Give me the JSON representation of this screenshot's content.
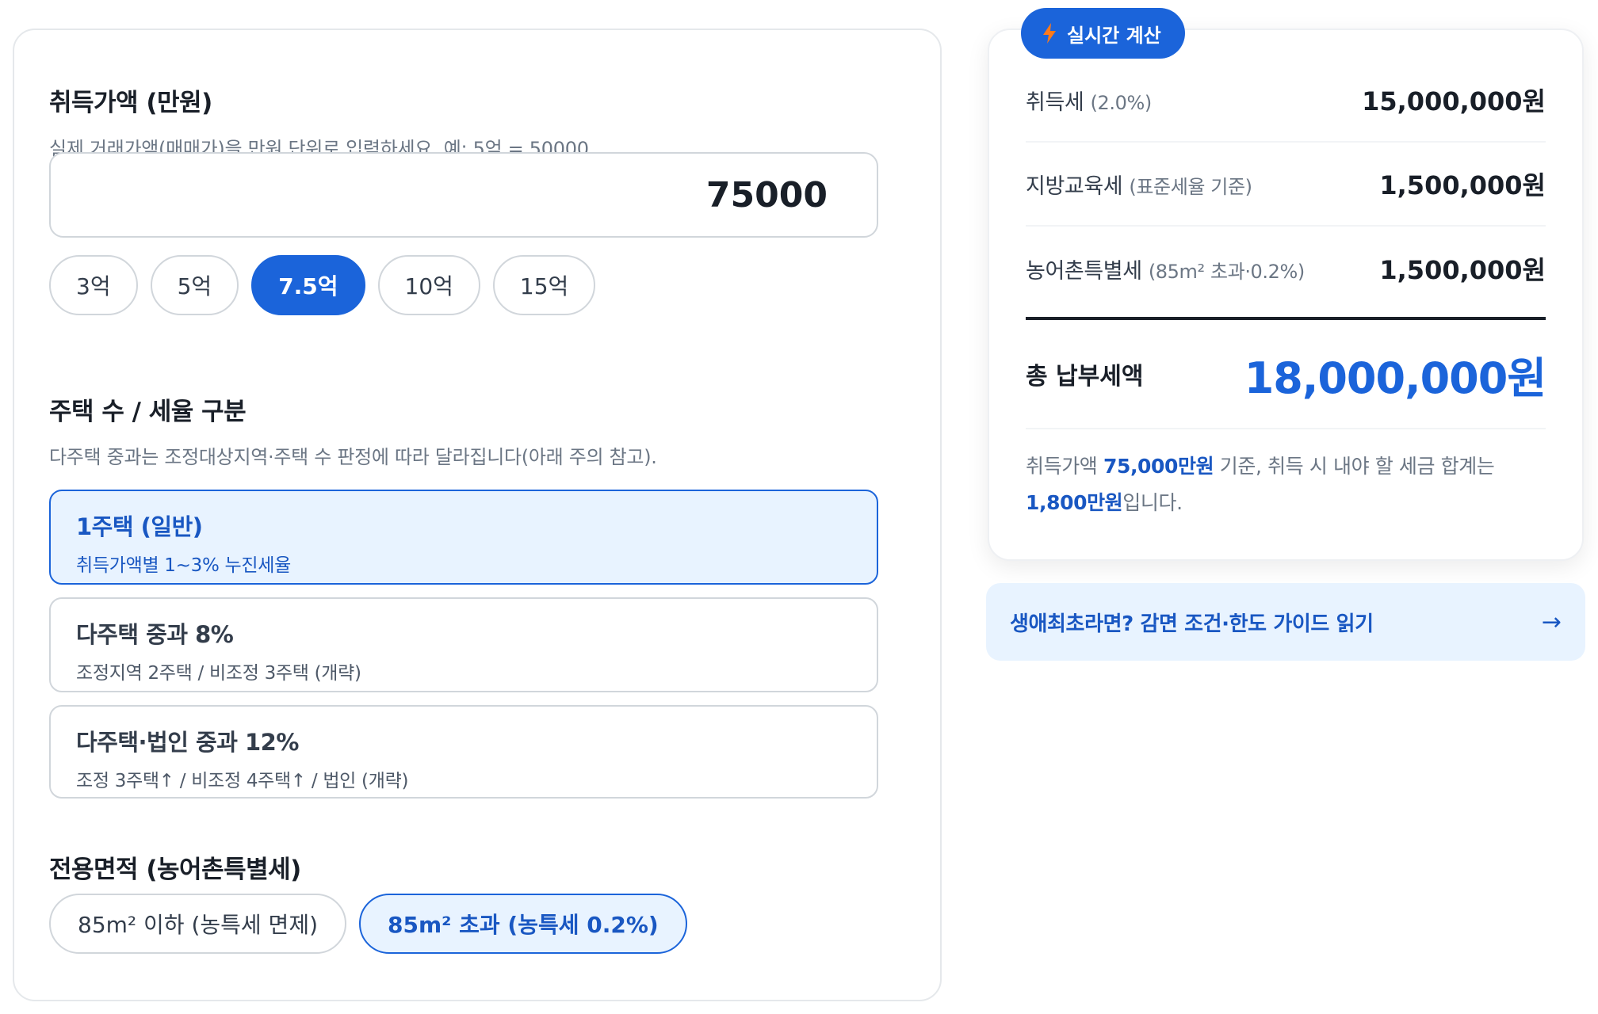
{
  "price": {
    "title": "취득가액 (만원)",
    "desc": "실제 거래가액(매매가)을 만원 단위로 입력하세요. 예: 5억 = 50000",
    "value": "75000",
    "presets": [
      {
        "label": "3억",
        "active": false
      },
      {
        "label": "5억",
        "active": false
      },
      {
        "label": "7.5억",
        "active": true
      },
      {
        "label": "10억",
        "active": false
      },
      {
        "label": "15억",
        "active": false
      }
    ]
  },
  "houses": {
    "title": "주택 수 / 세율 구분",
    "desc": "다주택 중과는 조정대상지역·주택 수 판정에 따라 달라집니다(아래 주의 참고).",
    "options": [
      {
        "title": "1주택 (일반)",
        "sub": "취득가액별 1~3% 누진세율",
        "selected": true
      },
      {
        "title": "다주택 중과 8%",
        "sub": "조정지역 2주택 / 비조정 3주택 (개략)",
        "selected": false
      },
      {
        "title": "다주택·법인 중과 12%",
        "sub": "조정 3주택↑ / 비조정 4주택↑ / 법인 (개략)",
        "selected": false
      }
    ]
  },
  "area": {
    "title": "전용면적 (농어촌특별세)",
    "options": [
      {
        "label": "85m² 이하 (농특세 면제)",
        "selected": false
      },
      {
        "label": "85m² 초과 (농특세 0.2%)",
        "selected": true
      }
    ]
  },
  "result": {
    "badge": "실시간 계산",
    "rows": [
      {
        "label": "취득세",
        "note": "(2.0%)",
        "value": "15,000,000원"
      },
      {
        "label": "지방교육세",
        "note": "(표준세율 기준)",
        "value": "1,500,000원"
      },
      {
        "label": "농어촌특별세",
        "note": "(85m² 초과·0.2%)",
        "value": "1,500,000원"
      }
    ],
    "total_label": "총 납부세액",
    "total_value": "18,000,000원",
    "summary": {
      "p1": "취득가액 ",
      "b1": "75,000만원",
      "p2": " 기준, 취득 시 내야 할 세금 합계는 ",
      "b2": "1,800만원",
      "p3": "입니다."
    }
  },
  "guide": {
    "label": "생애최초라면? 감면 조건·한도 가이드 읽기",
    "arrow": "→"
  },
  "colors": {
    "accent": "#1b64da",
    "accent_light": "#e8f3ff",
    "bolt": "#ff7a1a"
  }
}
